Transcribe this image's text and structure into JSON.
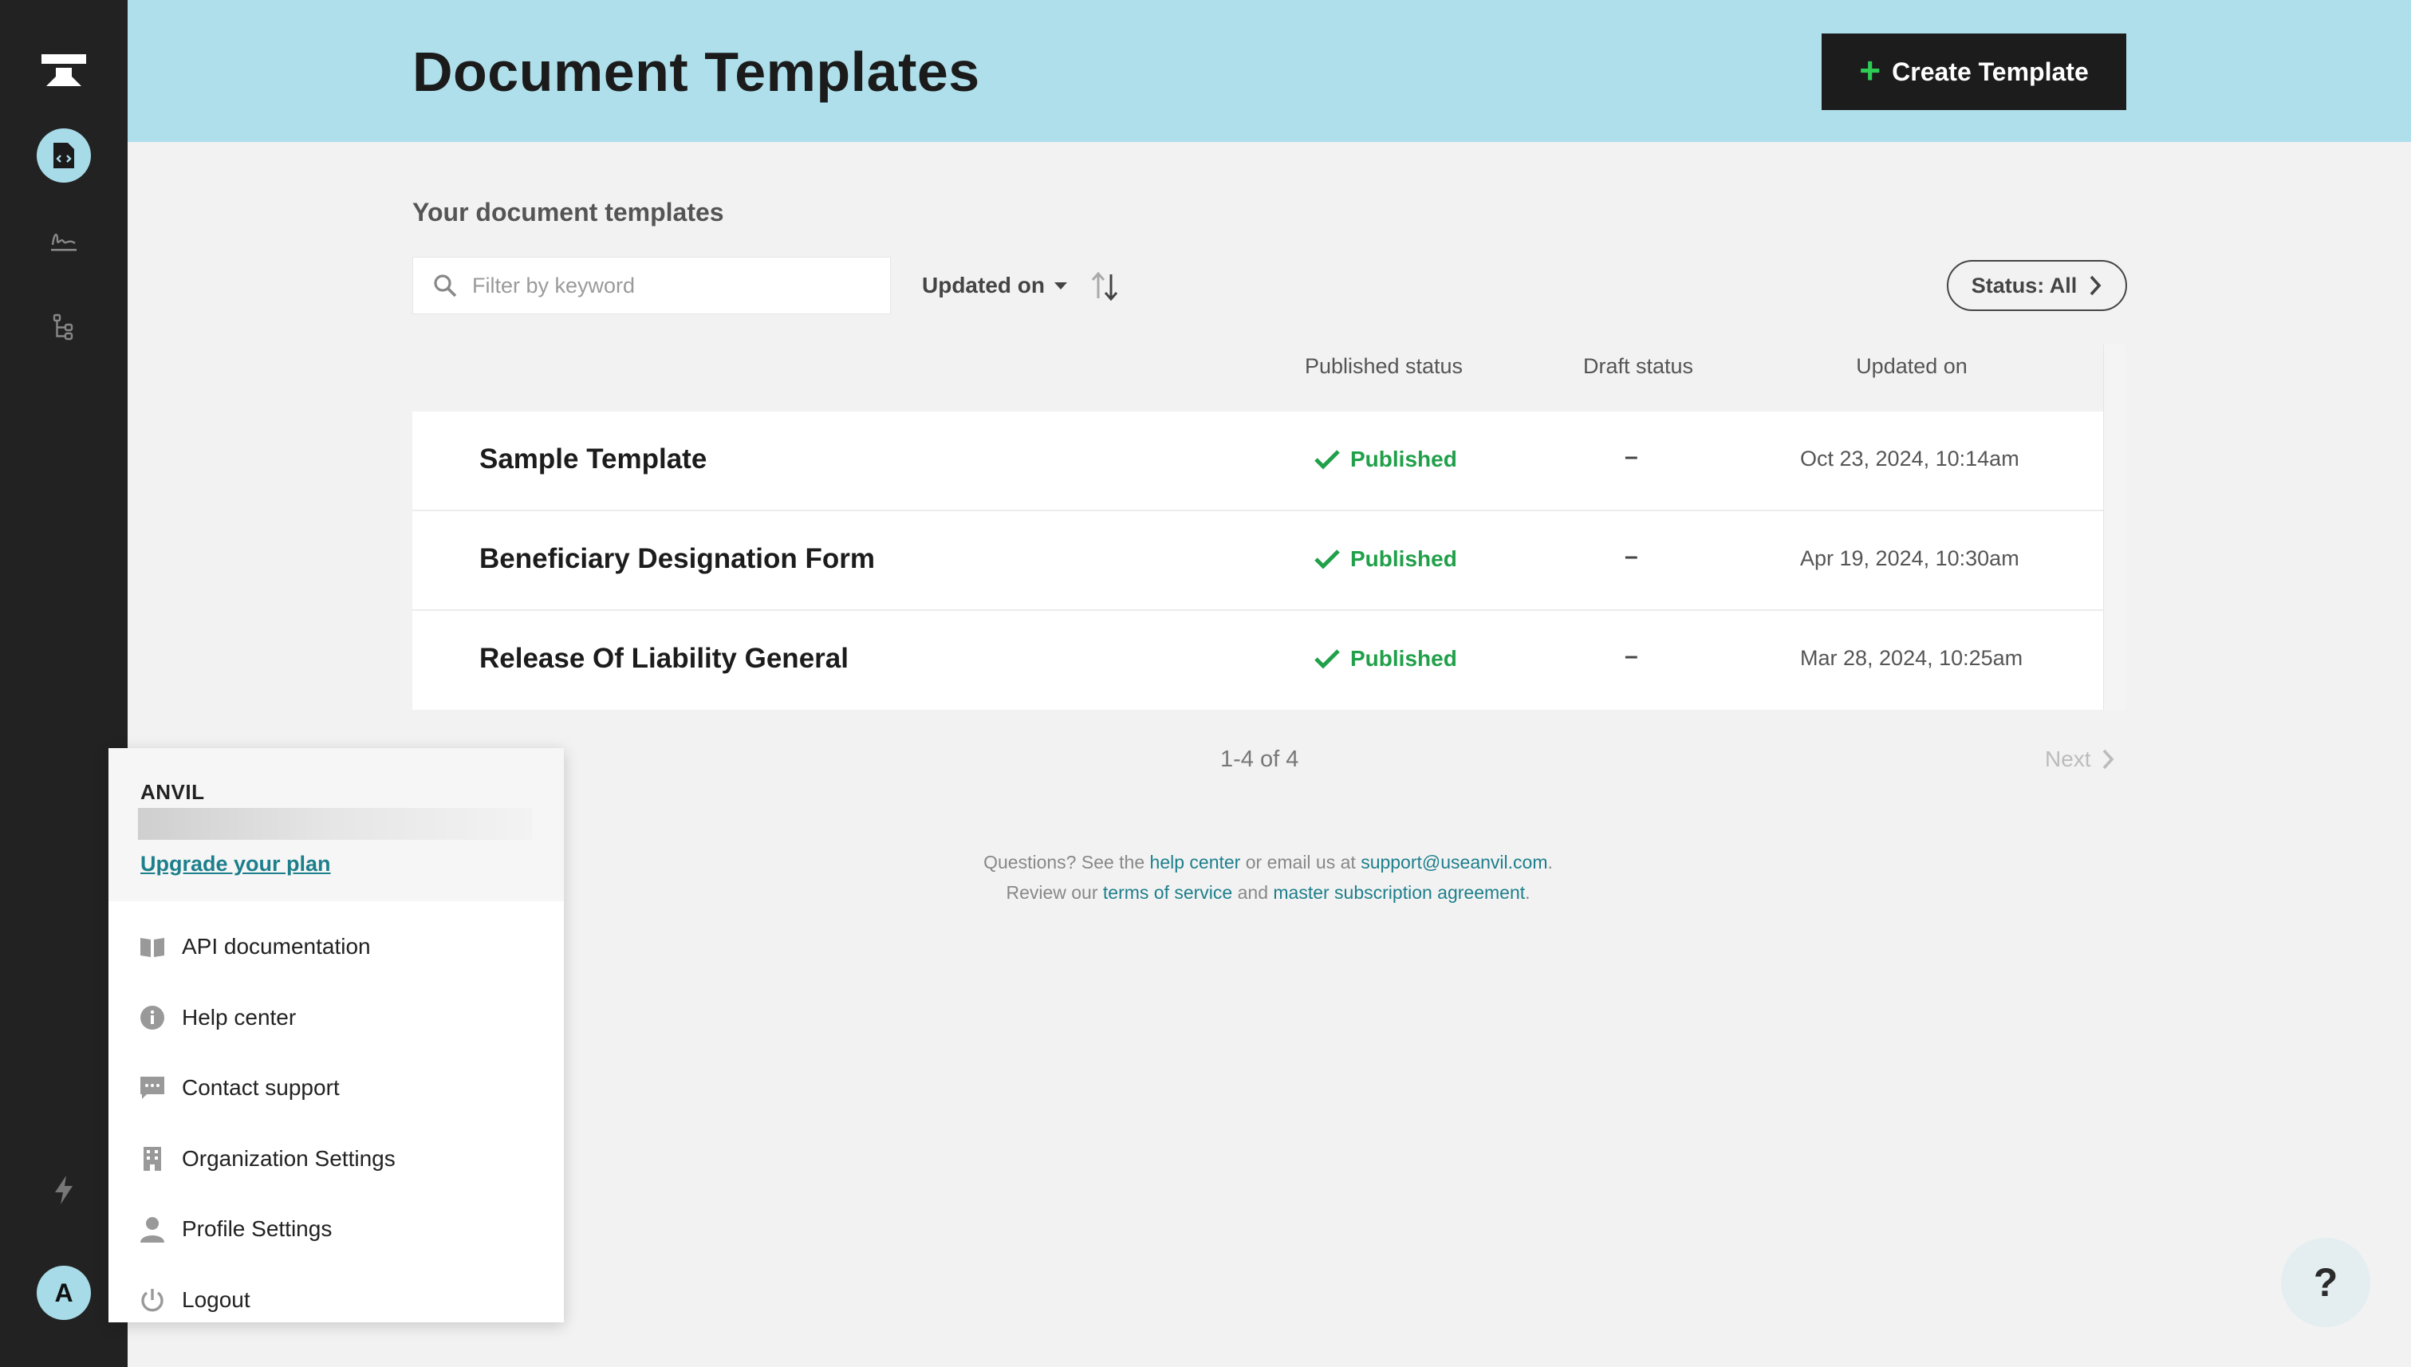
{
  "app": {
    "title": "Document Templates",
    "avatar_initial": "A"
  },
  "rail": {
    "items": [
      {
        "name": "templates-nav",
        "icon": "document-code-icon",
        "active": true
      },
      {
        "name": "signatures-nav",
        "icon": "signature-icon",
        "active": false
      },
      {
        "name": "workflows-nav",
        "icon": "workflow-tree-icon",
        "active": false
      }
    ],
    "bottom_icon": "lightning-icon"
  },
  "header": {
    "title": "Document Templates",
    "create_label": "Create Template"
  },
  "main": {
    "section_heading": "Your document templates",
    "search_placeholder": "Filter by keyword",
    "sort_label": "Updated on",
    "status_filter_label": "Status: All",
    "columns": {
      "published": "Published status",
      "draft": "Draft status",
      "updated": "Updated on"
    },
    "rows": [
      {
        "name": "Sample Template",
        "published": "Published",
        "draft": "–",
        "updated": "Oct 23, 2024, 10:14am"
      },
      {
        "name": "Beneficiary Designation Form",
        "published": "Published",
        "draft": "–",
        "updated": "Apr 19, 2024, 10:30am"
      },
      {
        "name": "Release Of Liability General",
        "published": "Published",
        "draft": "–",
        "updated": "Mar 28, 2024, 10:25am"
      }
    ],
    "pagination": {
      "count": "1-4 of 4",
      "next_label": "Next"
    }
  },
  "footer": {
    "line1_prefix": "Questions? See the",
    "help_center": "help center",
    "line1_mid": "or email us at",
    "email": "support@useanvil.com",
    "line1_end": ".",
    "line2_prefix": "Review our",
    "terms": "terms of service",
    "line2_mid": "and",
    "msa": "master subscription agreement",
    "line2_end": "."
  },
  "menu": {
    "org_name": "ANVIL",
    "upgrade_label": "Upgrade your plan",
    "items": [
      {
        "label": "API documentation",
        "icon": "book-icon"
      },
      {
        "label": "Help center",
        "icon": "info-icon"
      },
      {
        "label": "Contact support",
        "icon": "chat-icon"
      },
      {
        "label": "Organization Settings",
        "icon": "building-icon"
      },
      {
        "label": "Profile Settings",
        "icon": "person-icon"
      },
      {
        "label": "Logout",
        "icon": "power-icon"
      }
    ]
  },
  "help_fab": "?",
  "colors": {
    "rail": "#222222",
    "header": "#aedfeb",
    "accent": "#a7dbe8",
    "published": "#21a04a",
    "link": "#1d7f8c"
  }
}
